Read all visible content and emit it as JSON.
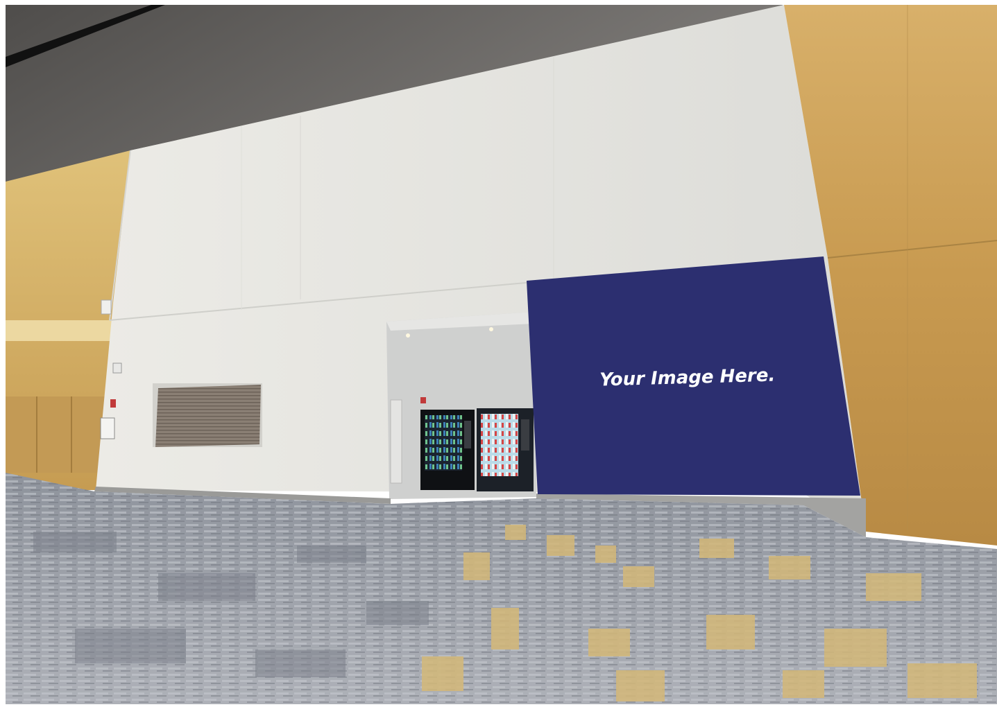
{
  "banner": {
    "text": "Your Image Here.",
    "color": "#2c2f70",
    "text_color": "#ffffff"
  },
  "colors": {
    "ceiling": "#6f6c68",
    "wall": "#e7e6e1",
    "gold_wall": "#c9a15c",
    "carpet": "#9ea2ab",
    "carpet_accent": "#d3b77a"
  }
}
